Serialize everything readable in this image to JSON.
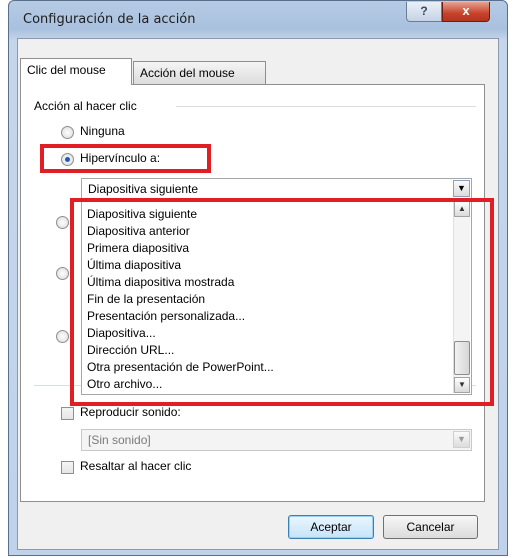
{
  "window": {
    "title": "Configuración de la acción",
    "help_label": "?",
    "close_label": "x"
  },
  "tabs": [
    {
      "label": "Clic del mouse",
      "active": true
    },
    {
      "label": "Acción del mouse",
      "active": false
    }
  ],
  "group": {
    "label": "Acción al hacer clic"
  },
  "options": {
    "none": {
      "label": "Ninguna",
      "checked": false
    },
    "hyperlink": {
      "label": "Hipervínculo a:",
      "checked": true
    }
  },
  "hyperlink_select": {
    "value": "Diapositiva siguiente"
  },
  "hyperlink_options": [
    "Diapositiva siguiente",
    "Diapositiva anterior",
    "Primera diapositiva",
    "Última diapositiva",
    "Última diapositiva mostrada",
    "Fin de la presentación",
    "Presentación personalizada...",
    "Diapositiva...",
    "Dirección URL...",
    "Otra presentación de PowerPoint...",
    "Otro archivo..."
  ],
  "sound": {
    "label": "Reproducir sonido:",
    "checked": false,
    "value": "[Sin sonido]"
  },
  "highlight": {
    "label": "Resaltar al hacer clic",
    "checked": false
  },
  "buttons": {
    "ok": "Aceptar",
    "cancel": "Cancelar"
  },
  "colors": {
    "highlight_box": "#e01e24",
    "titlebar": "#b6cbe4",
    "close_button": "#c7432a"
  }
}
